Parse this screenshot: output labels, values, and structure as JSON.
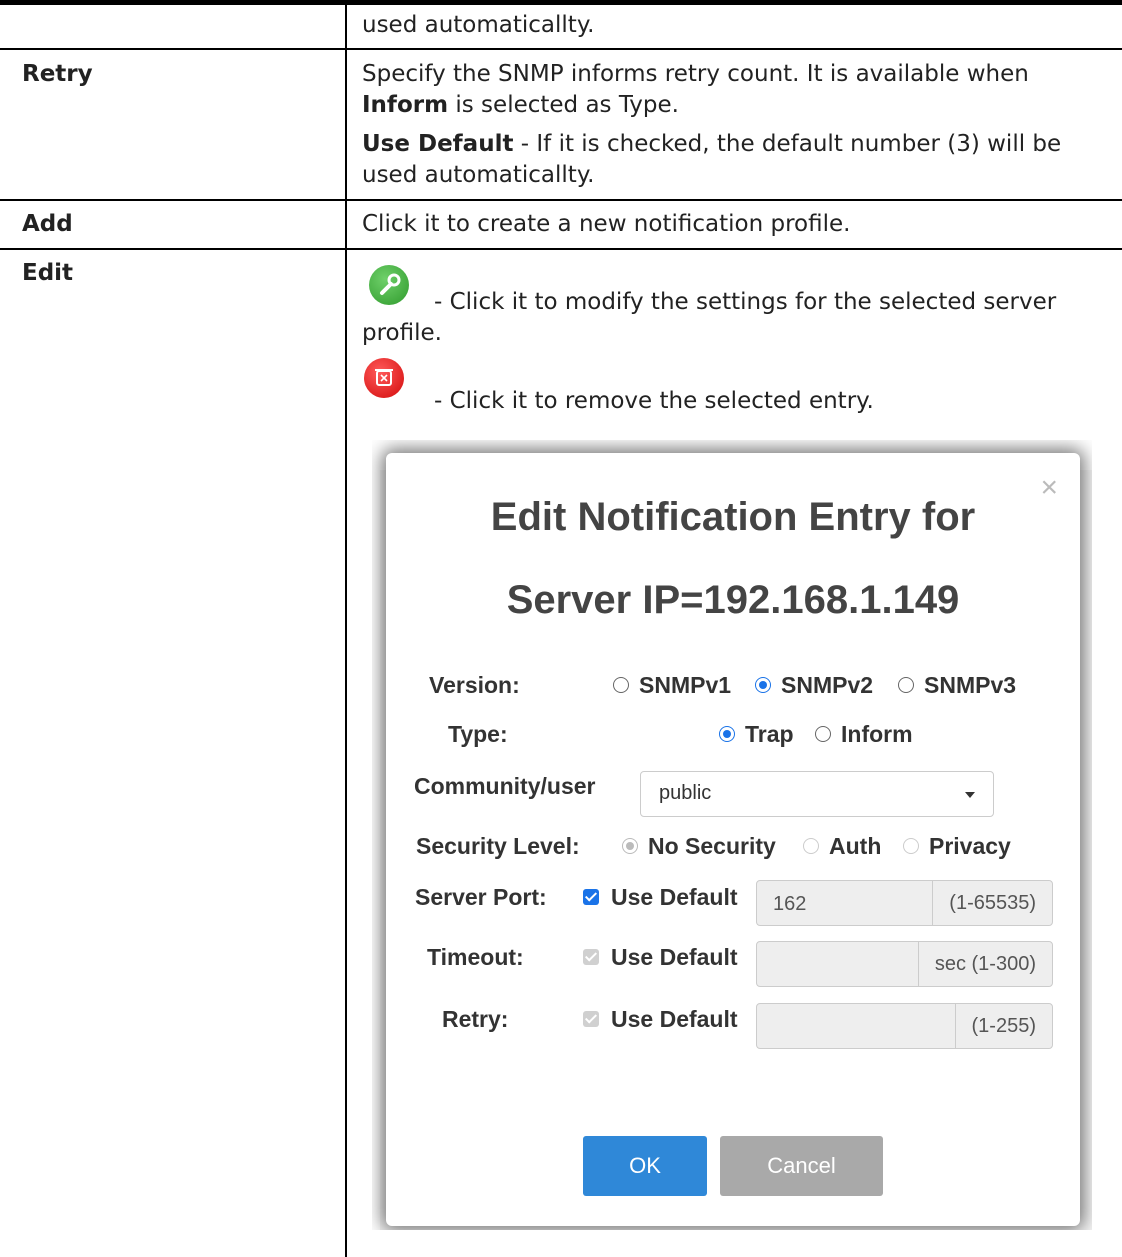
{
  "rows": [
    {
      "label": "",
      "desc": "used automaticallty."
    },
    {
      "label": "Retry",
      "desc_prefix": "Specify the SNMP informs retry count. It is available when ",
      "desc_bold": "Inform",
      "desc_suffix": " is selected as Type.",
      "note_bold": "Use Default",
      "note_text": " - If it is checked, the default number (3) will be used automaticallty."
    },
    {
      "label": "Add",
      "desc": "Click it to create a new notification profile."
    },
    {
      "label": "Edit",
      "edit_icon": "wrench-icon",
      "edit_text": "- Click it to modify the settings for the selected server profile.",
      "delete_icon": "trash-icon",
      "delete_text": "- Click it to remove the selected entry."
    }
  ],
  "dialog": {
    "title_line1": "Edit Notification Entry for",
    "title_line2": "Server IP=192.168.1.149",
    "version_label": "Version:",
    "version_options": [
      "SNMPv1",
      "SNMPv2",
      "SNMPv3"
    ],
    "version_selected": "SNMPv2",
    "type_label": "Type:",
    "type_options": [
      "Trap",
      "Inform"
    ],
    "type_selected": "Trap",
    "community_label": "Community/user",
    "community_value": "public",
    "security_label": "Security Level:",
    "security_options": [
      "No Security",
      "Auth",
      "Privacy"
    ],
    "security_selected": "No Security",
    "port_label": "Server Port:",
    "port_use_default": "Use Default",
    "port_value": "162",
    "port_range": "(1-65535)",
    "timeout_label": "Timeout:",
    "timeout_use_default": "Use Default",
    "timeout_range": "sec (1-300)",
    "retry_label": "Retry:",
    "retry_use_default": "Use Default",
    "retry_range": "(1-255)",
    "ok_label": "OK",
    "cancel_label": "Cancel"
  },
  "colors": {
    "accent": "#2f88d8",
    "wrench_icon": "#3aa535",
    "trash_icon": "#e01010"
  }
}
